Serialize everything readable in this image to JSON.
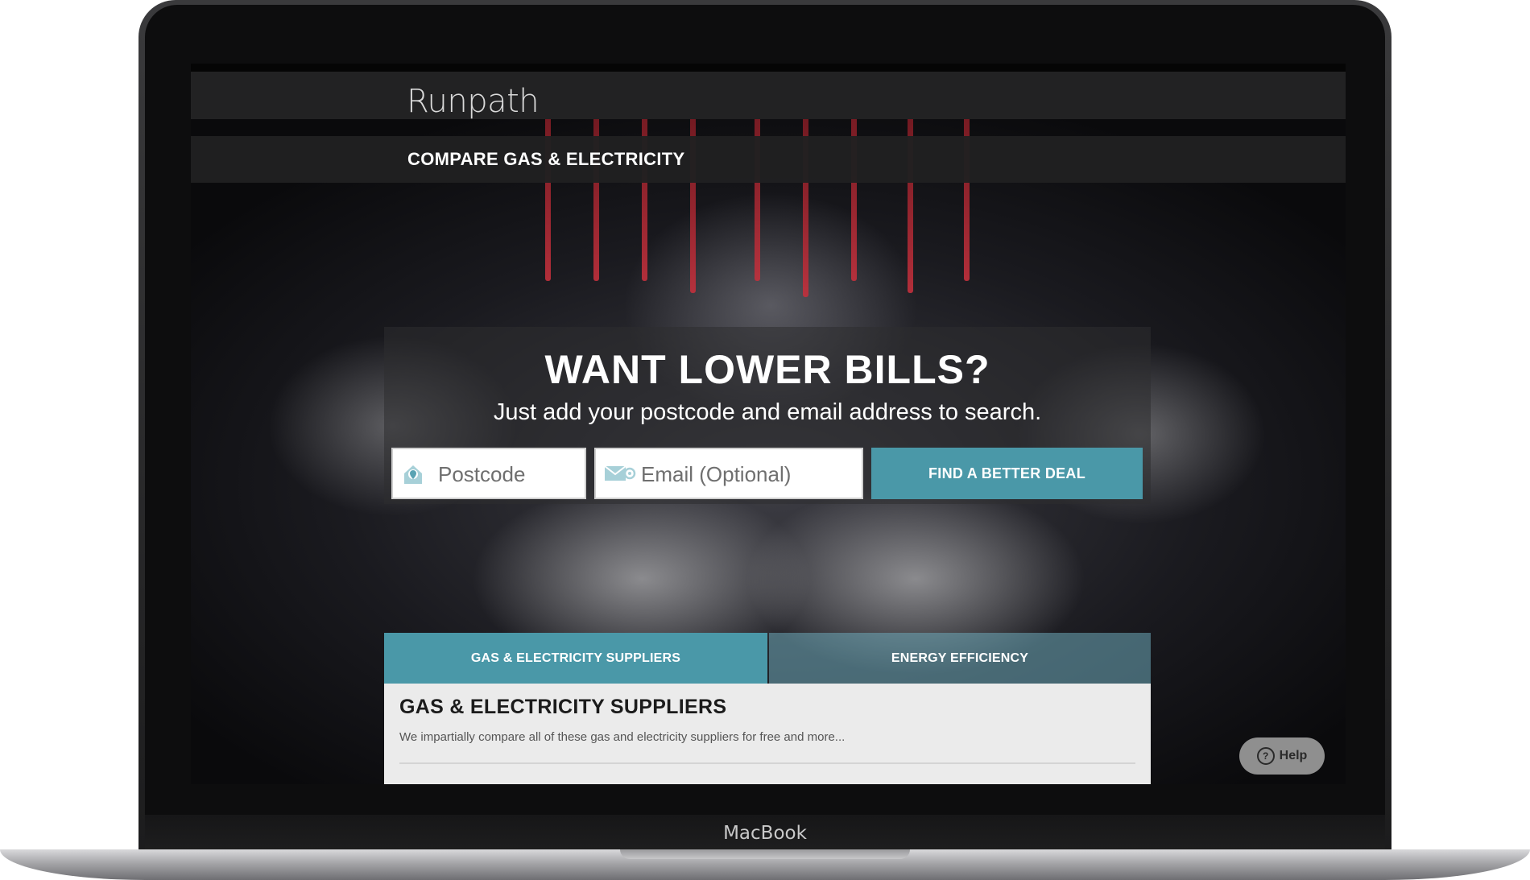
{
  "device": {
    "model_label": "MacBook"
  },
  "site": {
    "logo_text": "Runpath",
    "subnav_title": "COMPARE GAS & ELECTRICITY"
  },
  "hero": {
    "headline": "WANT LOWER BILLS?",
    "subheadline": "Just add your postcode and email address to search.",
    "postcode_placeholder": "Postcode",
    "email_placeholder": "Email (Optional)",
    "cta_label": "FIND A BETTER DEAL",
    "postcode_icon": "location-pin-icon",
    "email_icon": "email-icon"
  },
  "tabs": [
    {
      "label": "GAS & ELECTRICITY SUPPLIERS"
    },
    {
      "label": "ENERGY EFFICIENCY"
    }
  ],
  "content": {
    "title": "GAS & ELECTRICITY SUPPLIERS",
    "description": "We impartially compare all of these gas and electricity suppliers for free and more..."
  },
  "help": {
    "label": "Help",
    "icon": "question-circle-icon"
  },
  "colors": {
    "accent": "#4a98a8",
    "topbar": "#222223",
    "card_bg": "#ebebeb"
  }
}
